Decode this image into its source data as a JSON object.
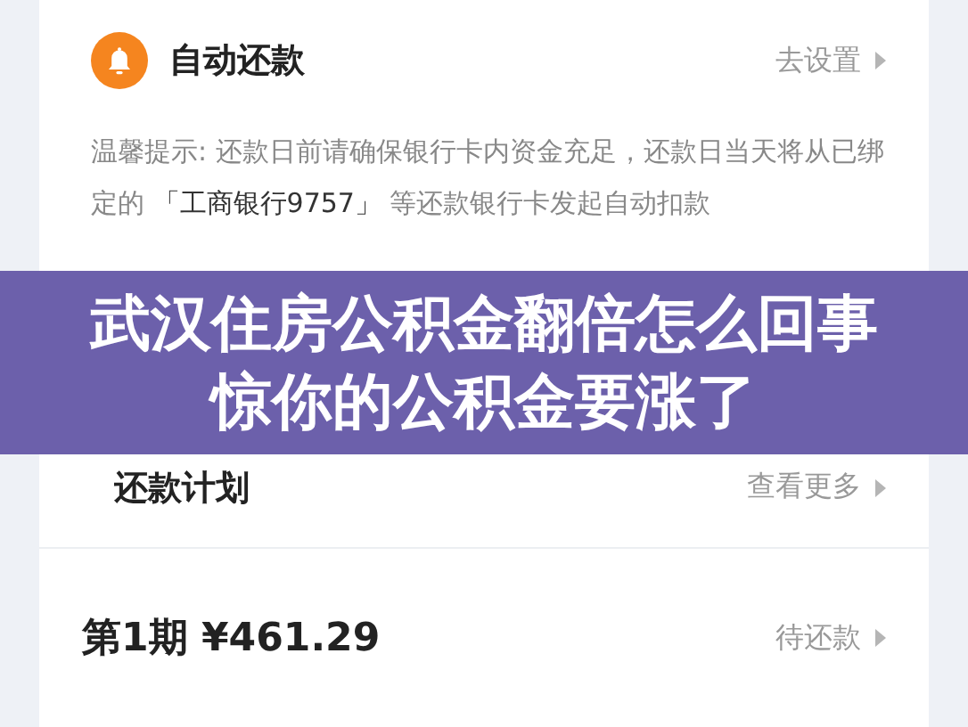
{
  "auto_repay": {
    "title": "自动还款",
    "action": "去设置",
    "tip": "温馨提示: 还款日前请确保银行卡内资金充足，还款日当天将从已绑定的 **「工商银行9757」** 等还款银行卡发起自动扣款"
  },
  "banner": {
    "lines": [
      "武汉住房公积金翻倍怎么回事",
      "惊你的公积金要涨了"
    ]
  },
  "plan": {
    "title": "还款计划",
    "action": "查看更多",
    "installments": [
      {
        "label": "第1期 ¥461.29",
        "status": "待还款"
      }
    ]
  }
}
